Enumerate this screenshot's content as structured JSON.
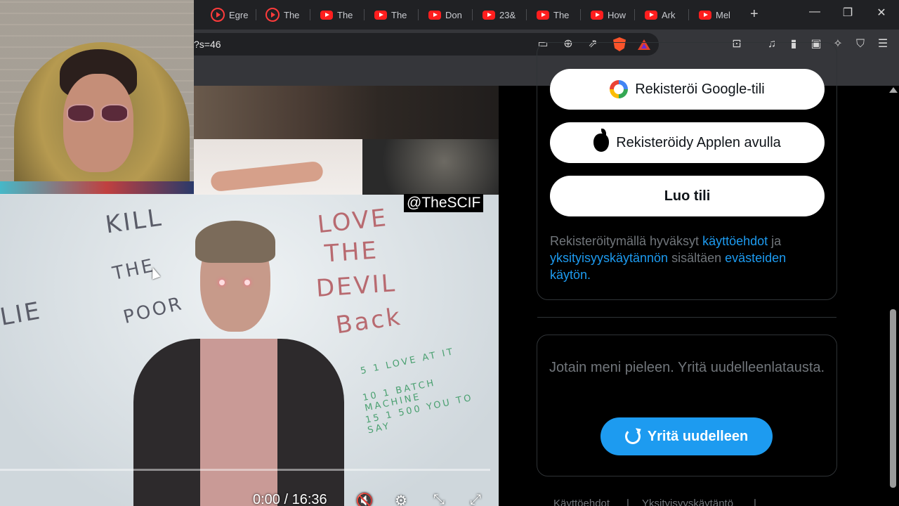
{
  "tabs": [
    {
      "label": "Egre",
      "icon": "youtube-ring-icon"
    },
    {
      "label": "The",
      "icon": "youtube-ring-icon"
    },
    {
      "label": "The",
      "icon": "youtube-icon"
    },
    {
      "label": "The",
      "icon": "youtube-icon"
    },
    {
      "label": "Don",
      "icon": "youtube-icon"
    },
    {
      "label": "23&",
      "icon": "youtube-icon"
    },
    {
      "label": "The",
      "icon": "youtube-icon"
    },
    {
      "label": "How",
      "icon": "youtube-icon"
    },
    {
      "label": "Ark",
      "icon": "youtube-icon"
    },
    {
      "label": "Mel",
      "icon": "youtube-icon"
    }
  ],
  "new_tab": "+",
  "window": {
    "minimize": "—",
    "restore": "❐",
    "close": "✕"
  },
  "address": {
    "url_fragment": "?s=46"
  },
  "video": {
    "watermark": "@TheSCIF",
    "time": "0:00 / 16:36",
    "board_text": {
      "kill": "KILL",
      "the": "THE",
      "poor": "POOR",
      "lie": "LIE",
      "love": "LOVE",
      "the2": "THE",
      "devil": "DEVIL",
      "back": "Back",
      "line1": "5 1 LOVE AT IT",
      "line2": "10 1 BATCH MACHINE",
      "line3": "15 1 500 YOU TO SAY"
    }
  },
  "signup": {
    "google_label": "Rekisteröi Google-tili",
    "apple_label": "Rekisteröidy Applen avulla",
    "create_label": "Luo tili",
    "terms_prefix": "Rekisteröitymällä hyväksyt ",
    "terms_link": "käyttöehdot",
    "terms_and": " ja ",
    "privacy_link": "yksityisyyskäytännön",
    "terms_mid": " sisältäen ",
    "cookies_link": "evästeiden käytön",
    "terms_end": "."
  },
  "error": {
    "message": "Jotain meni pieleen. Yritä uudelleenlatausta.",
    "retry_label": "Yritä uudelleen"
  },
  "footer": {
    "terms": "Käyttöehdot",
    "sep": "|",
    "privacy": "Yksityisyyskäytäntö",
    "sep2": "|"
  },
  "colors": {
    "accent": "#1d9bf0",
    "muted": "#71767b",
    "youtube": "#ff1e1e"
  }
}
